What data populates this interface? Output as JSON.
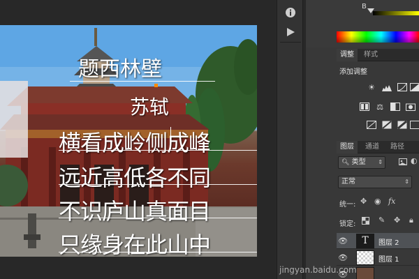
{
  "poem": {
    "title": "题西林壁",
    "author": "苏轼",
    "lines": [
      "横看成岭侧成峰",
      "远近高低各不同",
      "不识庐山真面目",
      "只缘身在此山中"
    ]
  },
  "color_panel": {
    "channel_label": "B"
  },
  "adjustments_panel": {
    "tabs": [
      "调整",
      "样式"
    ],
    "active_tab": "调整",
    "title": "添加调整"
  },
  "layers_panel": {
    "tabs": [
      "图层",
      "通道",
      "路径"
    ],
    "active_tab": "图层",
    "filter_kind": "类型",
    "blend_mode": "正常",
    "unify_label": "统一:",
    "lock_label": "锁定:",
    "layers": [
      {
        "name": "图层 2",
        "thumb": "T",
        "selected": true
      },
      {
        "name": "图层 1",
        "thumb": "",
        "selected": false
      }
    ]
  },
  "watermark": "jingyan.baidu.com",
  "colors": {
    "workspace": "#282828",
    "panel": "#383838",
    "selected_layer": "#4f5256",
    "sky": "#5aa3e3",
    "temple_red": "#8a2f26"
  },
  "icons": {
    "toolstrip": [
      "info-icon",
      "play-icon",
      "brush-icon",
      "sliders-icon",
      "stamp-icon",
      "char-icon",
      "paragraph-icon",
      "layers-icon",
      "glyph-icon",
      "crop-icon"
    ]
  }
}
